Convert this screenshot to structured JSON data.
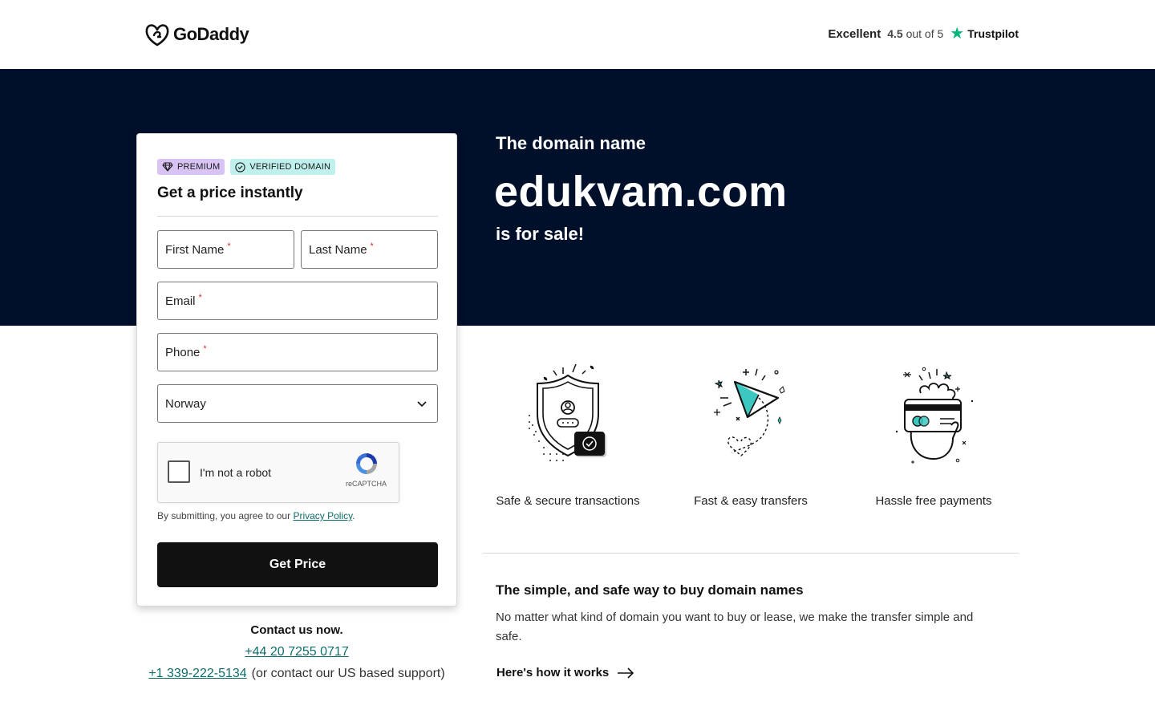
{
  "header": {
    "brand": "GoDaddy",
    "trust_rating_word": "Excellent",
    "trust_score": "4.5",
    "trust_score_suffix": "out of 5",
    "trust_brand": "Trustpilot"
  },
  "hero": {
    "kicker": "The domain name",
    "domain": "edukvam.com",
    "sale_text": "is for sale!"
  },
  "form": {
    "badge_premium": "PREMIUM",
    "badge_verified": "VERIFIED DOMAIN",
    "title": "Get a price instantly",
    "first_name_label": "First Name",
    "last_name_label": "Last Name",
    "email_label": "Email",
    "phone_label": "Phone",
    "required_mark": "*",
    "country_value": "Norway",
    "captcha_label": "I'm not a robot",
    "captcha_brand": "reCAPTCHA",
    "agree_prefix": "By submitting, you agree to our",
    "privacy_link": "Privacy Policy",
    "agree_suffix": ".",
    "submit_label": "Get Price"
  },
  "contact": {
    "title": "Contact us now.",
    "phone_primary": "+44 20 7255 0717",
    "phone_us": "+1 339-222-5134",
    "phone_us_note": "(or contact our US based support)"
  },
  "features": [
    {
      "label": "Safe & secure transactions",
      "icon": "shield-check-icon"
    },
    {
      "label": "Fast & easy transfers",
      "icon": "paper-plane-icon"
    },
    {
      "label": "Hassle free payments",
      "icon": "credit-card-hand-icon"
    }
  ],
  "info": {
    "title": "The simple, and safe way to buy domain names",
    "body": "No matter what kind of domain you want to buy or lease, we make the transfer simple and safe.",
    "link_label": "Here's how it works"
  },
  "colors": {
    "hero_bg": "#000f2a",
    "accent_teal": "#0e6d6a",
    "trustpilot_green": "#00b67a",
    "premium_badge": "#d9c3f5",
    "verified_badge": "#bff0ee",
    "cta_bg": "#111111"
  }
}
